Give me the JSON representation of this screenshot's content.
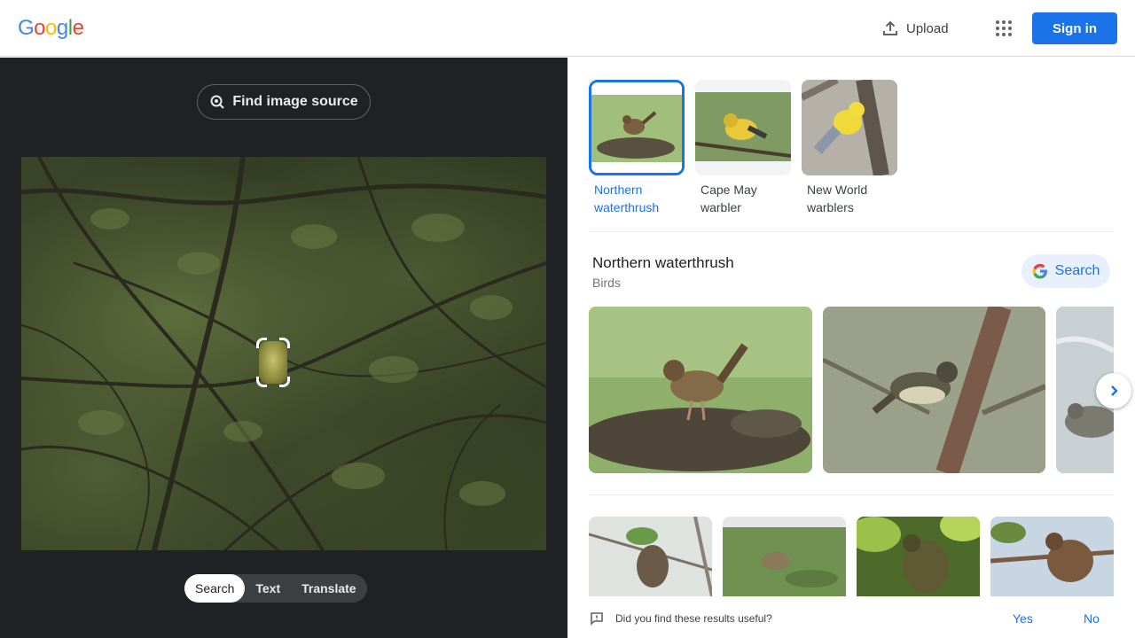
{
  "header": {
    "logo_letters": [
      "G",
      "o",
      "o",
      "g",
      "l",
      "e"
    ],
    "logo_colors": [
      "#4285f4",
      "#ea4335",
      "#fbbc05",
      "#4285f4",
      "#34a853",
      "#ea4335"
    ],
    "upload_label": "Upload",
    "apps_icon": "apps-grid-icon",
    "signin_label": "Sign in"
  },
  "left": {
    "find_source_label": "Find image source",
    "mode_tabs": [
      {
        "label": "Search",
        "active": true
      },
      {
        "label": "Text",
        "active": false
      },
      {
        "label": "Translate",
        "active": false
      }
    ]
  },
  "right": {
    "suggestions": [
      {
        "label": "Northern waterthrush",
        "active": true
      },
      {
        "label": "Cape May warbler",
        "active": false
      },
      {
        "label": "New World warblers",
        "active": false
      }
    ],
    "entity": {
      "title": "Northern waterthrush",
      "subtitle": "Birds",
      "search_label": "Search"
    },
    "feedback": {
      "question": "Did you find these results useful?",
      "yes": "Yes",
      "no": "No"
    }
  },
  "colors": {
    "accent": "#1a73e8",
    "left_bg": "#202124"
  }
}
